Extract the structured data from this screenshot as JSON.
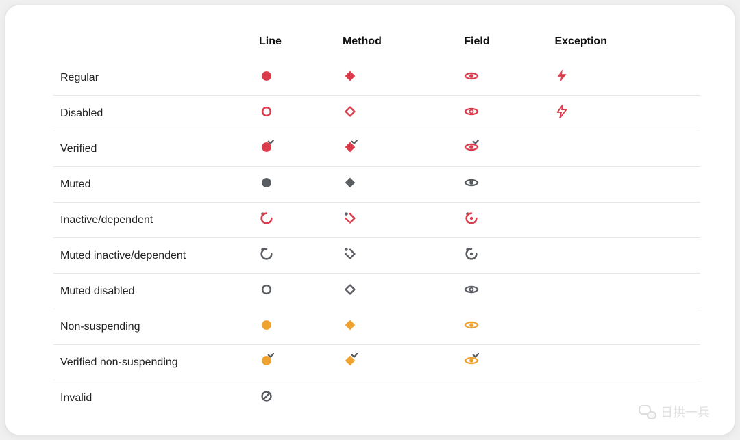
{
  "colors": {
    "red": "#DB3B4B",
    "orange": "#F0A22F",
    "gray": "#5A5D62"
  },
  "headers": {
    "line": "Line",
    "method": "Method",
    "field": "Field",
    "exception": "Exception"
  },
  "rows": [
    {
      "label": "Regular",
      "color": "red",
      "shape": "filled",
      "exception": "filled"
    },
    {
      "label": "Disabled",
      "color": "red",
      "shape": "outline",
      "exception": "outline"
    },
    {
      "label": "Verified",
      "color": "red",
      "shape": "filled",
      "tick": true
    },
    {
      "label": "Muted",
      "color": "gray",
      "shape": "filled"
    },
    {
      "label": "Inactive/dependent",
      "color": "red",
      "shape": "pending"
    },
    {
      "label": "Muted inactive/dependent",
      "color": "gray",
      "shape": "pending"
    },
    {
      "label": "Muted disabled",
      "color": "gray",
      "shape": "outline"
    },
    {
      "label": "Non-suspending",
      "color": "orange",
      "shape": "filled"
    },
    {
      "label": "Verified non-suspending",
      "color": "orange",
      "shape": "filled",
      "tick": true
    },
    {
      "label": "Invalid",
      "color": "gray",
      "shape": "invalid"
    }
  ],
  "watermark": "日拱一兵"
}
